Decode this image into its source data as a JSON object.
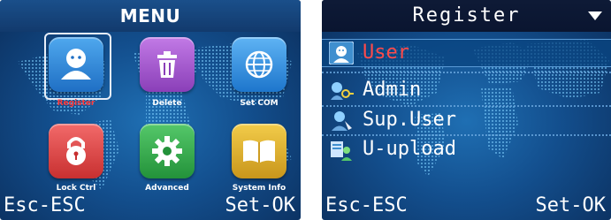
{
  "menu_screen": {
    "title": "MENU",
    "tiles": [
      {
        "label": "Register",
        "icon": "person-icon",
        "color": "#2e86d6",
        "selected": true
      },
      {
        "label": "Delete",
        "icon": "trash-icon",
        "color": "#9b4fc6",
        "selected": false
      },
      {
        "label": "Set COM",
        "icon": "globe-icon",
        "color": "#2b8fe0",
        "selected": false
      },
      {
        "label": "Lock Ctrl",
        "icon": "lock-icon",
        "color": "#e04848",
        "selected": false
      },
      {
        "label": "Advanced",
        "icon": "gear-icon",
        "color": "#2faa43",
        "selected": false
      },
      {
        "label": "System Info",
        "icon": "book-icon",
        "color": "#e0b42a",
        "selected": false
      }
    ],
    "softkeys": {
      "left": "Esc-ESC",
      "right": "Set-OK"
    }
  },
  "register_screen": {
    "title": "Register",
    "items": [
      {
        "label": "User",
        "icon": "user-face-icon",
        "selected": true
      },
      {
        "label": "Admin",
        "icon": "admin-key-icon",
        "selected": false
      },
      {
        "label": "Sup.User",
        "icon": "super-user-icon",
        "selected": false
      },
      {
        "label": "U-upload",
        "icon": "upload-user-icon",
        "selected": false
      }
    ],
    "softkeys": {
      "left": "Esc-ESC",
      "right": "Set-OK"
    }
  }
}
